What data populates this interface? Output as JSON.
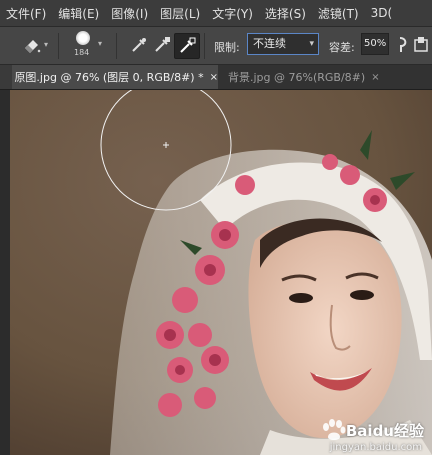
{
  "menu": {
    "items": [
      "文件(F)",
      "编辑(E)",
      "图像(I)",
      "图层(L)",
      "文字(Y)",
      "选择(S)",
      "滤镜(T)",
      "3D("
    ]
  },
  "options": {
    "brush_size": "184",
    "limits_label": "限制:",
    "limits_value": "不连续",
    "tolerance_label": "容差:",
    "tolerance_value": "50%"
  },
  "tabs": [
    {
      "label": "原图.jpg @ 76% (图层 0, RGB/8#) *",
      "close": "×"
    },
    {
      "label": "背景.jpg @ 76%(RGB/8#)",
      "close": "×"
    }
  ],
  "watermark": {
    "brand": "Baidu经验",
    "url": "jingyan.baidu.com"
  },
  "colors": {
    "photo_background": "#6e5a4a",
    "limit_select_border": "#5b86c7"
  }
}
